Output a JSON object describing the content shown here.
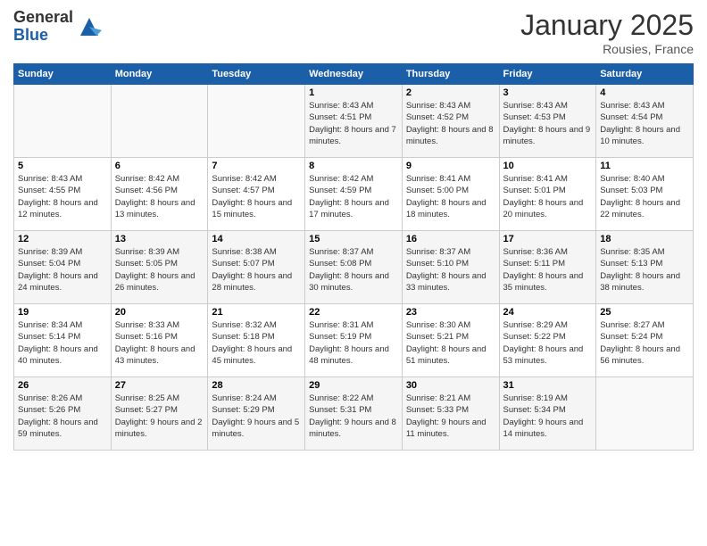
{
  "header": {
    "logo_general": "General",
    "logo_blue": "Blue",
    "month_title": "January 2025",
    "location": "Rousies, France"
  },
  "days_of_week": [
    "Sunday",
    "Monday",
    "Tuesday",
    "Wednesday",
    "Thursday",
    "Friday",
    "Saturday"
  ],
  "weeks": [
    [
      {
        "day": "",
        "info": ""
      },
      {
        "day": "",
        "info": ""
      },
      {
        "day": "",
        "info": ""
      },
      {
        "day": "1",
        "info": "Sunrise: 8:43 AM\nSunset: 4:51 PM\nDaylight: 8 hours\nand 7 minutes."
      },
      {
        "day": "2",
        "info": "Sunrise: 8:43 AM\nSunset: 4:52 PM\nDaylight: 8 hours\nand 8 minutes."
      },
      {
        "day": "3",
        "info": "Sunrise: 8:43 AM\nSunset: 4:53 PM\nDaylight: 8 hours\nand 9 minutes."
      },
      {
        "day": "4",
        "info": "Sunrise: 8:43 AM\nSunset: 4:54 PM\nDaylight: 8 hours\nand 10 minutes."
      }
    ],
    [
      {
        "day": "5",
        "info": "Sunrise: 8:43 AM\nSunset: 4:55 PM\nDaylight: 8 hours\nand 12 minutes."
      },
      {
        "day": "6",
        "info": "Sunrise: 8:42 AM\nSunset: 4:56 PM\nDaylight: 8 hours\nand 13 minutes."
      },
      {
        "day": "7",
        "info": "Sunrise: 8:42 AM\nSunset: 4:57 PM\nDaylight: 8 hours\nand 15 minutes."
      },
      {
        "day": "8",
        "info": "Sunrise: 8:42 AM\nSunset: 4:59 PM\nDaylight: 8 hours\nand 17 minutes."
      },
      {
        "day": "9",
        "info": "Sunrise: 8:41 AM\nSunset: 5:00 PM\nDaylight: 8 hours\nand 18 minutes."
      },
      {
        "day": "10",
        "info": "Sunrise: 8:41 AM\nSunset: 5:01 PM\nDaylight: 8 hours\nand 20 minutes."
      },
      {
        "day": "11",
        "info": "Sunrise: 8:40 AM\nSunset: 5:03 PM\nDaylight: 8 hours\nand 22 minutes."
      }
    ],
    [
      {
        "day": "12",
        "info": "Sunrise: 8:39 AM\nSunset: 5:04 PM\nDaylight: 8 hours\nand 24 minutes."
      },
      {
        "day": "13",
        "info": "Sunrise: 8:39 AM\nSunset: 5:05 PM\nDaylight: 8 hours\nand 26 minutes."
      },
      {
        "day": "14",
        "info": "Sunrise: 8:38 AM\nSunset: 5:07 PM\nDaylight: 8 hours\nand 28 minutes."
      },
      {
        "day": "15",
        "info": "Sunrise: 8:37 AM\nSunset: 5:08 PM\nDaylight: 8 hours\nand 30 minutes."
      },
      {
        "day": "16",
        "info": "Sunrise: 8:37 AM\nSunset: 5:10 PM\nDaylight: 8 hours\nand 33 minutes."
      },
      {
        "day": "17",
        "info": "Sunrise: 8:36 AM\nSunset: 5:11 PM\nDaylight: 8 hours\nand 35 minutes."
      },
      {
        "day": "18",
        "info": "Sunrise: 8:35 AM\nSunset: 5:13 PM\nDaylight: 8 hours\nand 38 minutes."
      }
    ],
    [
      {
        "day": "19",
        "info": "Sunrise: 8:34 AM\nSunset: 5:14 PM\nDaylight: 8 hours\nand 40 minutes."
      },
      {
        "day": "20",
        "info": "Sunrise: 8:33 AM\nSunset: 5:16 PM\nDaylight: 8 hours\nand 43 minutes."
      },
      {
        "day": "21",
        "info": "Sunrise: 8:32 AM\nSunset: 5:18 PM\nDaylight: 8 hours\nand 45 minutes."
      },
      {
        "day": "22",
        "info": "Sunrise: 8:31 AM\nSunset: 5:19 PM\nDaylight: 8 hours\nand 48 minutes."
      },
      {
        "day": "23",
        "info": "Sunrise: 8:30 AM\nSunset: 5:21 PM\nDaylight: 8 hours\nand 51 minutes."
      },
      {
        "day": "24",
        "info": "Sunrise: 8:29 AM\nSunset: 5:22 PM\nDaylight: 8 hours\nand 53 minutes."
      },
      {
        "day": "25",
        "info": "Sunrise: 8:27 AM\nSunset: 5:24 PM\nDaylight: 8 hours\nand 56 minutes."
      }
    ],
    [
      {
        "day": "26",
        "info": "Sunrise: 8:26 AM\nSunset: 5:26 PM\nDaylight: 8 hours\nand 59 minutes."
      },
      {
        "day": "27",
        "info": "Sunrise: 8:25 AM\nSunset: 5:27 PM\nDaylight: 9 hours\nand 2 minutes."
      },
      {
        "day": "28",
        "info": "Sunrise: 8:24 AM\nSunset: 5:29 PM\nDaylight: 9 hours\nand 5 minutes."
      },
      {
        "day": "29",
        "info": "Sunrise: 8:22 AM\nSunset: 5:31 PM\nDaylight: 9 hours\nand 8 minutes."
      },
      {
        "day": "30",
        "info": "Sunrise: 8:21 AM\nSunset: 5:33 PM\nDaylight: 9 hours\nand 11 minutes."
      },
      {
        "day": "31",
        "info": "Sunrise: 8:19 AM\nSunset: 5:34 PM\nDaylight: 9 hours\nand 14 minutes."
      },
      {
        "day": "",
        "info": ""
      }
    ]
  ]
}
